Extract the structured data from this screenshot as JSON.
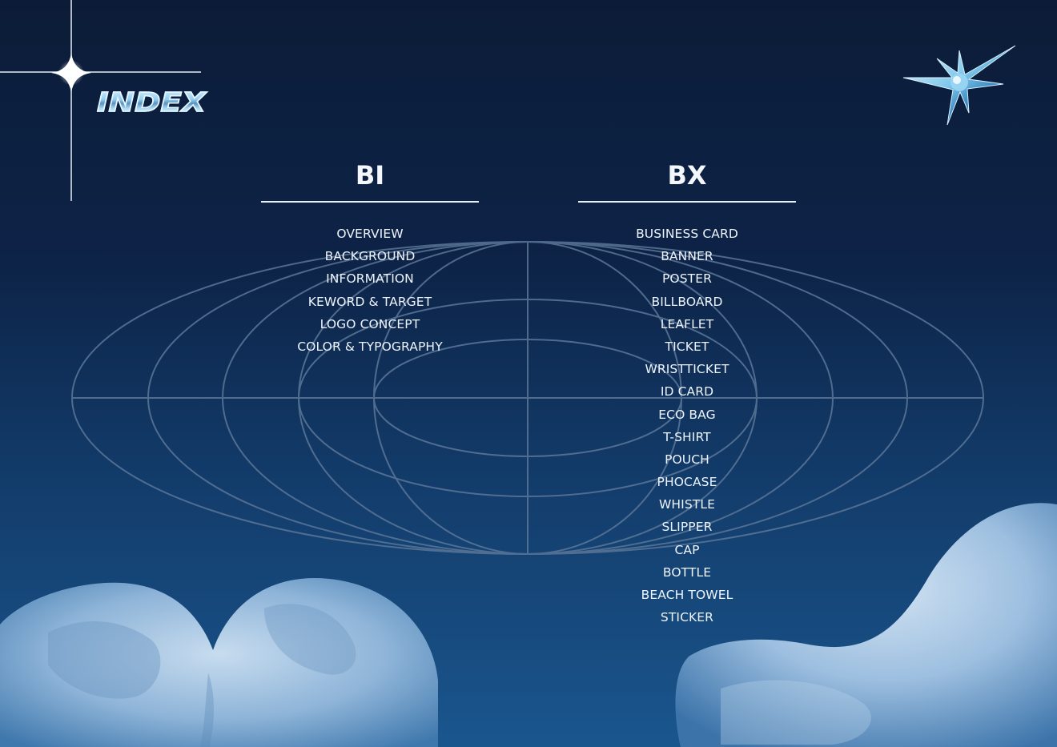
{
  "header": {
    "title": "INDEX"
  },
  "columns": {
    "bi": {
      "heading": "BI",
      "items": [
        "OVERVIEW",
        "BACKGROUND",
        "INFORMATION",
        "KEWORD & TARGET",
        "LOGO CONCEPT",
        "COLOR & TYPOGRAPHY"
      ]
    },
    "bx": {
      "heading": "BX",
      "items": [
        "BUSINESS CARD",
        "BANNER",
        "POSTER",
        "BILLBOARD",
        "LEAFLET",
        "TICKET",
        "WRISTTICKET",
        "ID CARD",
        "ECO BAG",
        "T-SHIRT",
        "POUCH",
        "PHOCASE",
        "WHISTLE",
        "SLIPPER",
        "CAP",
        "BOTTLE",
        "BEACH TOWEL",
        "STICKER"
      ]
    }
  },
  "colors": {
    "background_top": "#0c1c38",
    "background_bottom": "#1a568e",
    "text": "#eef4fb",
    "globe_lines": "#5b7698",
    "blob": "#9fc2e0"
  },
  "decorations": {
    "sparkle": "four-point-sparkle-icon",
    "star": "chrome-star-icon",
    "globe": "wireframe-globe-graphic",
    "blobs": [
      "heart-blob-left",
      "wave-blob-right"
    ]
  }
}
